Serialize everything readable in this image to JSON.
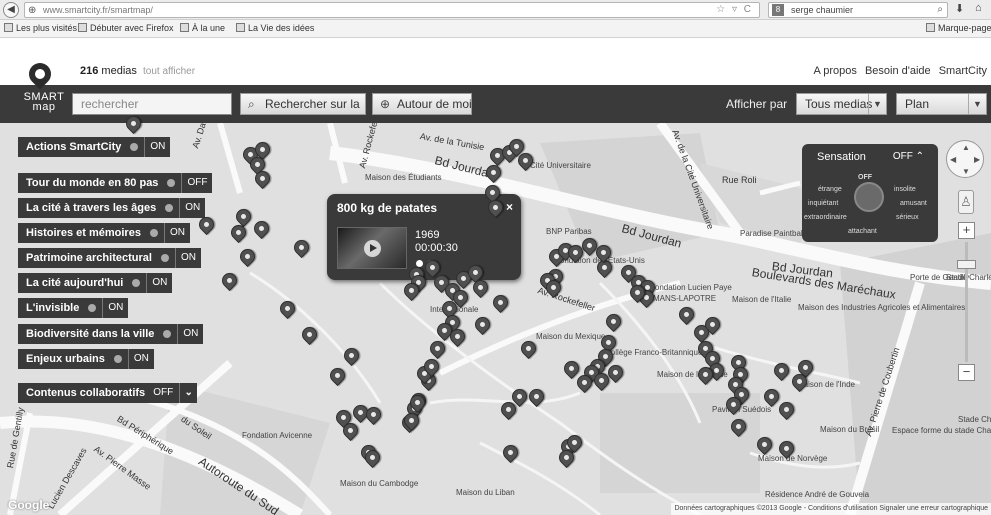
{
  "browser": {
    "url": "www.smartcity.fr/smartmap/",
    "search_text": "serge chaumier",
    "bookmarks": [
      "Les plus visités",
      "Débuter avec Firefox",
      "À la une",
      "La Vie des idées"
    ],
    "bookmark_right": "Marque-page"
  },
  "header": {
    "media_count": "216",
    "media_label": "medias",
    "show_all": "tout afficher",
    "links": [
      "A propos",
      "Besoin d'aide",
      "SmartCity"
    ],
    "logo_line1": "SMART",
    "logo_line2": "map"
  },
  "toolbar": {
    "search_placeholder": "rechercher",
    "search_button": "Rechercher sur la",
    "around_button": "Autour de moi",
    "display_label": "Afficher par",
    "filter_select": "Tous medias",
    "view_select": "Plan"
  },
  "layers": [
    {
      "label": "Actions SmartCity",
      "state": "ON"
    },
    {
      "label": "Tour du monde en 80 pas",
      "state": "OFF"
    },
    {
      "label": "La cité à travers les âges",
      "state": "ON"
    },
    {
      "label": "Histoires et mémoires",
      "state": "ON"
    },
    {
      "label": "Patrimoine architectural",
      "state": "ON"
    },
    {
      "label": "La cité aujourd'hui",
      "state": "ON"
    },
    {
      "label": "L'invisible",
      "state": "ON"
    },
    {
      "label": "Biodiversité dans la ville",
      "state": "ON"
    },
    {
      "label": "Enjeux urbains",
      "state": "ON"
    }
  ],
  "collab": {
    "label": "Contenus collaboratifs",
    "state": "OFF"
  },
  "popup": {
    "title": "800 kg de patates",
    "close": "×",
    "year": "1969",
    "duration": "00:00:30",
    "dot_colors": [
      "#ffffff",
      "#777777"
    ]
  },
  "sensation": {
    "title": "Sensation",
    "state": "OFF",
    "center": "OFF",
    "labels": [
      "étrange",
      "insolite",
      "inquiétant",
      "amusant",
      "extraordinaire",
      "sérieux",
      "attachant"
    ]
  },
  "map": {
    "roads": [
      "Av. de la Tunisie",
      "Bd Jourdan",
      "Bd Jourdan",
      "Bd Jourdan",
      "Boulevards des Maréchaux",
      "Rue Roli",
      "Av. de la Cité Universitaire",
      "Av. Pierre Masse",
      "Bd Périphérique",
      "Autoroute du Sud",
      "Rue de Gentilly",
      "Lucien Descaves",
      "Av. Pierre de Coubertin",
      "Av. Rockefeller",
      "Av. Rockefeller",
      "Av. David Weill",
      "du Soleil"
    ],
    "pois": [
      "Maison des Étudiants",
      "Cité Universitaire",
      "BNP Paribas",
      "Paradise Paintball",
      "Fondation des États-Unis",
      "Fondation Lucien Paye",
      "MANS-LAPOTRE",
      "Maison de l'Italie",
      "Maison des Industries Agricoles et Alimentaires",
      "Maison du Mexique",
      "Collège Franco-Britannique",
      "Maison de la Suède",
      "Pavillon Suédois",
      "Maison de l'Inde",
      "Maison du Brésil",
      "Maison de Norvège",
      "Fondation Avicenne",
      "Maison du Cambodge",
      "Maison du Liban",
      "Résidence André de Gouveia",
      "Espace forme du stade Charléty",
      "Stade Charléty",
      "Porte de Gentilly",
      "Stade Charlety",
      "Internationale"
    ],
    "google": "Google",
    "copyright": "Données cartographiques ©2013 Google - Conditions d'utilisation   Signaler une erreur cartographique",
    "pin_count": 110
  },
  "controls": {
    "zoom_in": "+",
    "zoom_out": "−"
  }
}
